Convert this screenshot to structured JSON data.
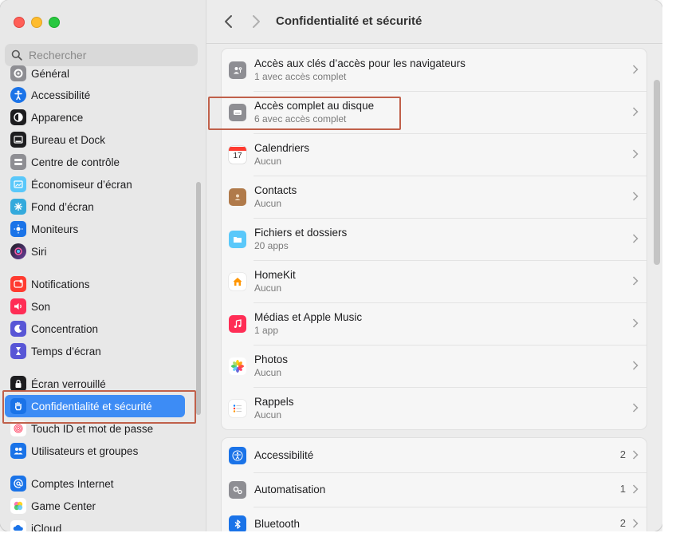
{
  "window": {
    "title": "Confidentialité et sécurité"
  },
  "search": {
    "placeholder": "Rechercher"
  },
  "sidebar": {
    "items": [
      {
        "label": "Général",
        "icon": "gear-icon",
        "color": "#8e8e93"
      },
      {
        "label": "Accessibilité",
        "icon": "accessibility-icon",
        "color": "#1a73e8"
      },
      {
        "label": "Apparence",
        "icon": "appearance-icon",
        "color": "#1d1d1f"
      },
      {
        "label": "Bureau et Dock",
        "icon": "dock-icon",
        "color": "#1d1d1f"
      },
      {
        "label": "Centre de contrôle",
        "icon": "control-center-icon",
        "color": "#8e8e93"
      },
      {
        "label": "Économiseur d’écran",
        "icon": "screensaver-icon",
        "color": "#5ac8fa"
      },
      {
        "label": "Fond d’écran",
        "icon": "wallpaper-icon",
        "color": "#34aadc"
      },
      {
        "label": "Moniteurs",
        "icon": "displays-icon",
        "color": "#1a73e8"
      },
      {
        "label": "Siri",
        "icon": "siri-icon",
        "color": "#6b3fa0"
      },
      {
        "label": "Notifications",
        "icon": "notifications-icon",
        "color": "#ff3b30"
      },
      {
        "label": "Son",
        "icon": "sound-icon",
        "color": "#ff2d55"
      },
      {
        "label": "Concentration",
        "icon": "focus-icon",
        "color": "#5856d6"
      },
      {
        "label": "Temps d’écran",
        "icon": "screen-time-icon",
        "color": "#5856d6"
      },
      {
        "label": "Écran verrouillé",
        "icon": "lock-screen-icon",
        "color": "#1d1d1f"
      },
      {
        "label": "Confidentialité et sécurité",
        "icon": "privacy-hand-icon",
        "color": "#1a73e8"
      },
      {
        "label": "Touch ID et mot de passe",
        "icon": "fingerprint-icon",
        "color": "#ffffff"
      },
      {
        "label": "Utilisateurs et groupes",
        "icon": "users-icon",
        "color": "#1a73e8"
      },
      {
        "label": "Comptes Internet",
        "icon": "at-icon",
        "color": "#1a73e8"
      },
      {
        "label": "Game Center",
        "icon": "game-center-icon",
        "color": "#ffffff"
      },
      {
        "label": "iCloud",
        "icon": "icloud-icon",
        "color": "#1a73e8"
      }
    ],
    "selected_index": 14
  },
  "content": {
    "group1": [
      {
        "title": "Accès aux clés d’accès pour les navigateurs",
        "subtitle": "1 avec accès complet",
        "icon": "passkey-person-icon"
      },
      {
        "title": "Accès complet au disque",
        "subtitle": "6 avec accès complet",
        "icon": "disk-icon"
      },
      {
        "title": "Calendriers",
        "subtitle": "Aucun",
        "icon": "calendar-icon",
        "calendar_day": "17"
      },
      {
        "title": "Contacts",
        "subtitle": "Aucun",
        "icon": "contacts-icon"
      },
      {
        "title": "Fichiers et dossiers",
        "subtitle": "20 apps",
        "icon": "folder-icon"
      },
      {
        "title": "HomeKit",
        "subtitle": "Aucun",
        "icon": "home-icon"
      },
      {
        "title": "Médias et Apple Music",
        "subtitle": "1 app",
        "icon": "music-note-icon"
      },
      {
        "title": "Photos",
        "subtitle": "Aucun",
        "icon": "photos-icon"
      },
      {
        "title": "Rappels",
        "subtitle": "Aucun",
        "icon": "reminders-icon"
      }
    ],
    "group2": [
      {
        "title": "Accessibilité",
        "count": "2",
        "icon": "accessibility-icon"
      },
      {
        "title": "Automatisation",
        "count": "1",
        "icon": "automation-gears-icon"
      },
      {
        "title": "Bluetooth",
        "count": "2",
        "icon": "bluetooth-icon"
      }
    ]
  },
  "colors": {
    "accent": "#3d8cf5",
    "highlight_annotation": "#c0604a"
  }
}
